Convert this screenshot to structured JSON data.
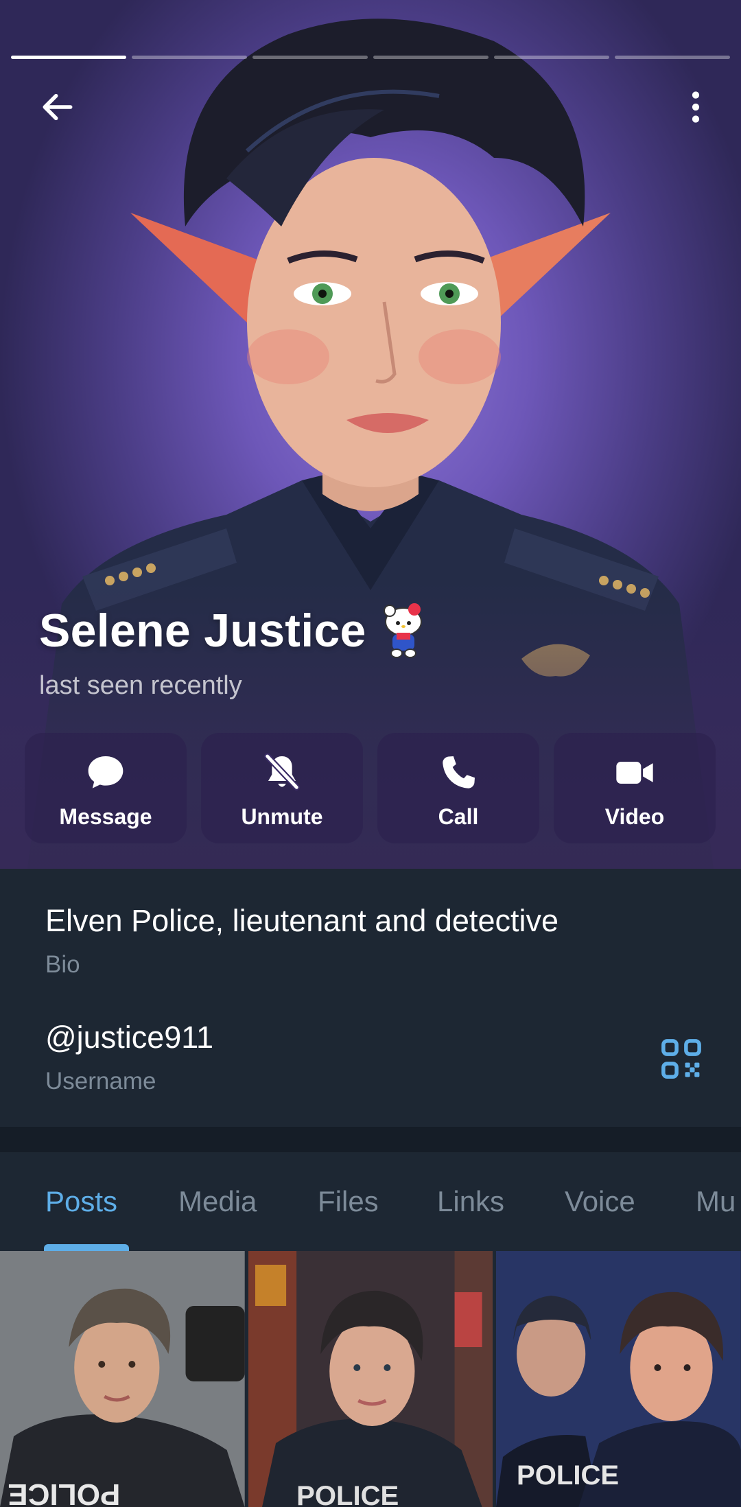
{
  "stories": {
    "count": 6,
    "active_index": 0
  },
  "header": {
    "back_icon": "arrow-left-icon",
    "more_icon": "more-vertical-icon"
  },
  "profile": {
    "name": "Selene Justice",
    "emoji_status": "hello-kitty-sticker",
    "status": "last seen recently"
  },
  "actions": [
    {
      "label": "Message",
      "icon": "message-bubble-icon"
    },
    {
      "label": "Unmute",
      "icon": "bell-off-icon"
    },
    {
      "label": "Call",
      "icon": "phone-icon"
    },
    {
      "label": "Video",
      "icon": "video-camera-icon"
    }
  ],
  "info": {
    "bio": "Elven Police, lieutenant and detective",
    "bio_label": "Bio",
    "username": "@justice911",
    "username_label": "Username",
    "qr_icon": "qr-code-icon"
  },
  "tabs": [
    "Posts",
    "Media",
    "Files",
    "Links",
    "Voice",
    "Mu"
  ],
  "active_tab": "Posts",
  "media": [
    {
      "alt_icon": "photo-thumbnail",
      "badge_text": "POLICE"
    },
    {
      "alt_icon": "photo-thumbnail",
      "badge_text": "POLICE"
    },
    {
      "alt_icon": "photo-thumbnail",
      "badge_text": "POLICE"
    }
  ],
  "colors": {
    "accent": "#5eaee8",
    "panel": "#1d2733",
    "secondary_text": "#7d8b99",
    "hero_purple": "#6d57b8"
  }
}
